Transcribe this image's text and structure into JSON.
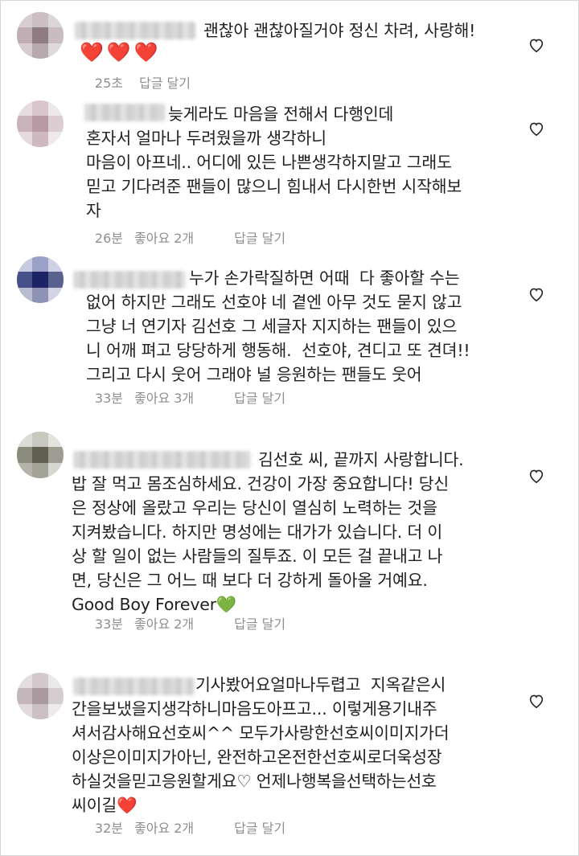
{
  "comments": [
    {
      "text": "괜찮아 괜찮아질거야 정신 차려, 사랑해!",
      "emoji": [
        "❤️",
        "❤️",
        "❤️"
      ],
      "time": "25초",
      "likes": "",
      "reply": "답글 달기"
    },
    {
      "text": "늦게라도 마음을 전해서 다행인데\n혼자서 얼마나 두려웠을까 생각하니\n마음이 아프네.. 어디에 있든 나쁜생각하지말고 그래도\n믿고 기다려준 팬들이 많으니 힘내서 다시한번 시작해보\n자",
      "time": "26분",
      "likes": "좋아요 2개",
      "reply": "답글 달기"
    },
    {
      "text": "누가 손가락질하면 어때  다 좋아할 수는\n없어 하지만 그래도 선호야 네 곁엔 아무 것도 묻지 않고\n그냥 너 연기자 김선호 그 세글자 지지하는 팬들이 있으\n니 어깨 펴고 당당하게 행동해.  선호야, 견디고 또 견뎌!!\n그리고 다시 웃어 그래야 널 응원하는 팬들도 웃어",
      "time": "33분",
      "likes": "좋아요 3개",
      "reply": "답글 달기"
    },
    {
      "text": "김선호 씨, 끝까지 사랑합니다.\n밥 잘 먹고 몸조심하세요. 건강이 가장 중요합니다! 당신\n은 정상에 올랐고 우리는 당신이 열심히 노력하는 것을\n지켜봤습니다. 하지만 명성에는 대가가 있습니다. 더 이\n상 할 일이 없는 사람들의 질투죠. 이 모든 걸 끝내고 나\n면, 당신은 그 어느 때 보다 더 강하게 돌아올 거예요.\nGood Boy Forever💚",
      "time": "33분",
      "likes": "좋아요 2개",
      "reply": "답글 달기"
    },
    {
      "text": "기사봤어요얼마나두렵고  지옥같은시\n간을보냈을지생각하니마음도아프고... 이렇게용기내주\n셔서감사해요선호씨^^ 모두가사랑한선호씨이미지가더\n이상은이미지가아닌, 완전하고온전한선호씨로더욱성장\n하실것을믿고응원할게요♡ 언제나행복을선택하는선호\n씨이길❤️",
      "time": "32분",
      "likes": "좋아요 2개",
      "reply": "답글 달기"
    }
  ],
  "icons": {
    "like": "heart-outline-icon"
  },
  "colors": {
    "text": "#1f1f1f",
    "meta": "#8e8e8e",
    "heart": "#ed4956"
  }
}
